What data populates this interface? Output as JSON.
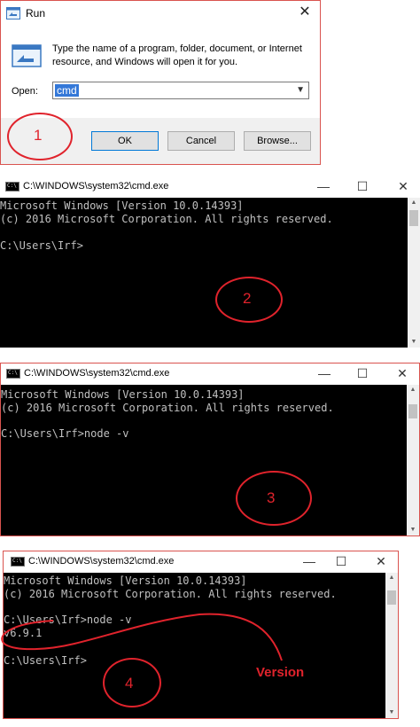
{
  "run": {
    "title": "Run",
    "close": "✕",
    "description": "Type the name of a program, folder, document, or Internet resource, and Windows will open it for you.",
    "open_label": "Open:",
    "open_value": "cmd",
    "ok": "OK",
    "cancel": "Cancel",
    "browse": "Browse..."
  },
  "markers": [
    "1",
    "2",
    "3",
    "4"
  ],
  "cmd": {
    "title": "C:\\WINDOWS\\system32\\cmd.exe",
    "icon_text": "C:\\",
    "min": "—",
    "max": "☐",
    "close": "✕",
    "line1": "Microsoft Windows [Version 10.0.14393]",
    "line2": "(c) 2016 Microsoft Corporation. All rights reserved.",
    "prompt": "C:\\Users\\Irf>",
    "prompt_node": "C:\\Users\\Irf>node -v",
    "version_output": "v6.9.1"
  },
  "annotation": {
    "version_label": "Version",
    "color": "#e0232c"
  }
}
